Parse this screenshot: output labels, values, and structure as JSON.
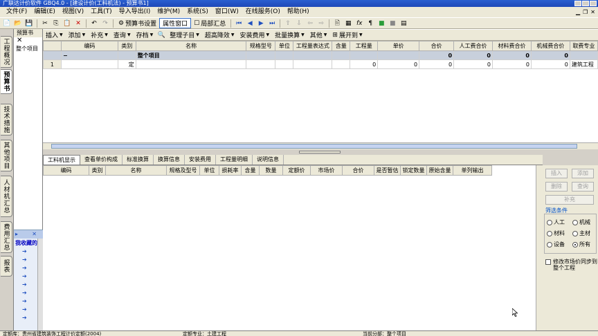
{
  "window": {
    "title": "广联达计价软件 GBQ4.0 - [建设计价(工料机法) - 预算书1]"
  },
  "menu": [
    "文件(F)",
    "编辑(E)",
    "视图(V)",
    "工具(T)",
    "导入导出(I)",
    "维护(M)",
    "系统(S)",
    "窗口(W)",
    "在线服务(O)",
    "帮助(H)"
  ],
  "toolbar1": {
    "budget_settings": "预算书设置",
    "property_window": "属性窗口",
    "local_summary": "局部汇总"
  },
  "toolbar2": [
    "插入",
    "添加",
    "补充",
    "查询",
    "存档",
    "整理子目",
    "超高降效",
    "安装费用",
    "批量换算",
    "其他",
    "展开到"
  ],
  "left_tabs": [
    "工程概况",
    "预算书",
    "技术措施",
    "其他项目",
    "人材机汇总",
    "费用汇总",
    "报表"
  ],
  "tree": {
    "header": "预算书",
    "close": "✕",
    "root": "整个项目"
  },
  "favorites": {
    "label": "我收藏的"
  },
  "main_grid": {
    "columns": [
      "",
      "编码",
      "类别",
      "名称",
      "规格型号",
      "单位",
      "工程量表达式",
      "含量",
      "工程量",
      "单价",
      "合价",
      "人工费合价",
      "材料费合价",
      "机械费合价",
      "取费专业"
    ],
    "summary_row": {
      "marker": "−",
      "name": "整个项目",
      "values": [
        "0",
        "0",
        "0",
        "0"
      ]
    },
    "data_row": {
      "index": "1",
      "code": "",
      "type": "定",
      "quantity": "0",
      "unit_price": "0",
      "total": "0",
      "labor": "0",
      "material": "0",
      "machine": "0",
      "specialty": "建筑工程"
    }
  },
  "bottom_tabs": [
    "工料机显示",
    "查看单价构成",
    "标准换算",
    "换算信息",
    "安装费用",
    "工程量明细",
    "说明信息"
  ],
  "sub_grid": {
    "columns": [
      "编码",
      "类别",
      "名称",
      "规格及型号",
      "单位",
      "损耗率",
      "含量",
      "数量",
      "定额价",
      "市场价",
      "合价",
      "是否暂估",
      "锁定数量",
      "原始含量",
      "单列输出"
    ]
  },
  "right_panel": {
    "buttons": [
      "插入",
      "添加",
      "删除",
      "查询",
      "补充"
    ],
    "filter_title": "筛选条件",
    "filters": [
      "人工",
      "机械",
      "材料",
      "主材",
      "设备",
      "所有"
    ],
    "selected_filter": "所有",
    "sync_text": "修改市场价同步到整个工程"
  },
  "status": {
    "quota_lib": "定额库：贵州省建筑装饰工程计价定额(2004)",
    "specialty": "定额专业：土建工程",
    "current_part": "当前分部：整个项目"
  }
}
